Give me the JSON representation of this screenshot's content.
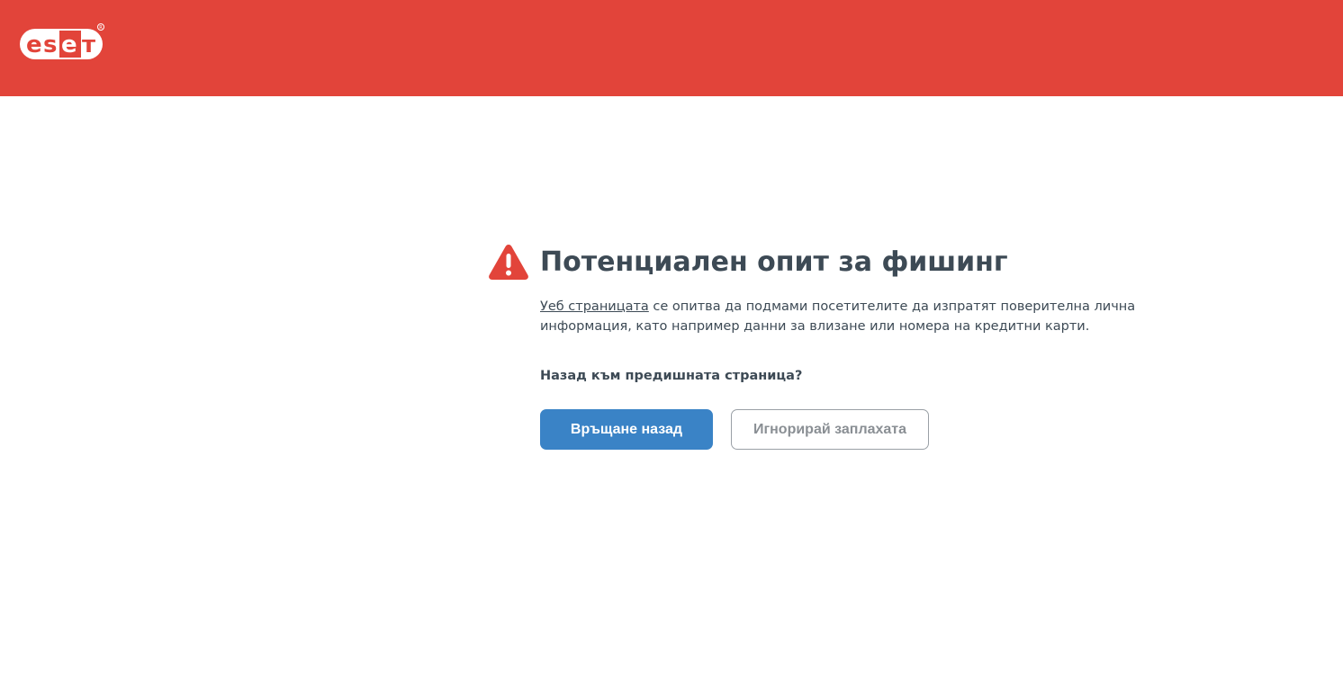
{
  "header": {
    "brand": "eset",
    "brand_color": "#e2443a",
    "logo_icon": "eset-logo"
  },
  "warning": {
    "icon": "warning-triangle-icon",
    "icon_color": "#e2443a",
    "title": "Потенциален опит за фишинг",
    "link_text": "Уеб страницата",
    "description_rest": " се опитва да подмами посетителите да изпратят поверителна лична информация, като например данни за влизане или номера на кредитни карти.",
    "question": "Назад към предишната страница?"
  },
  "actions": {
    "back_label": "Връщане назад",
    "ignore_label": "Игнорирай заплахата",
    "primary_color": "#3a83c6"
  }
}
